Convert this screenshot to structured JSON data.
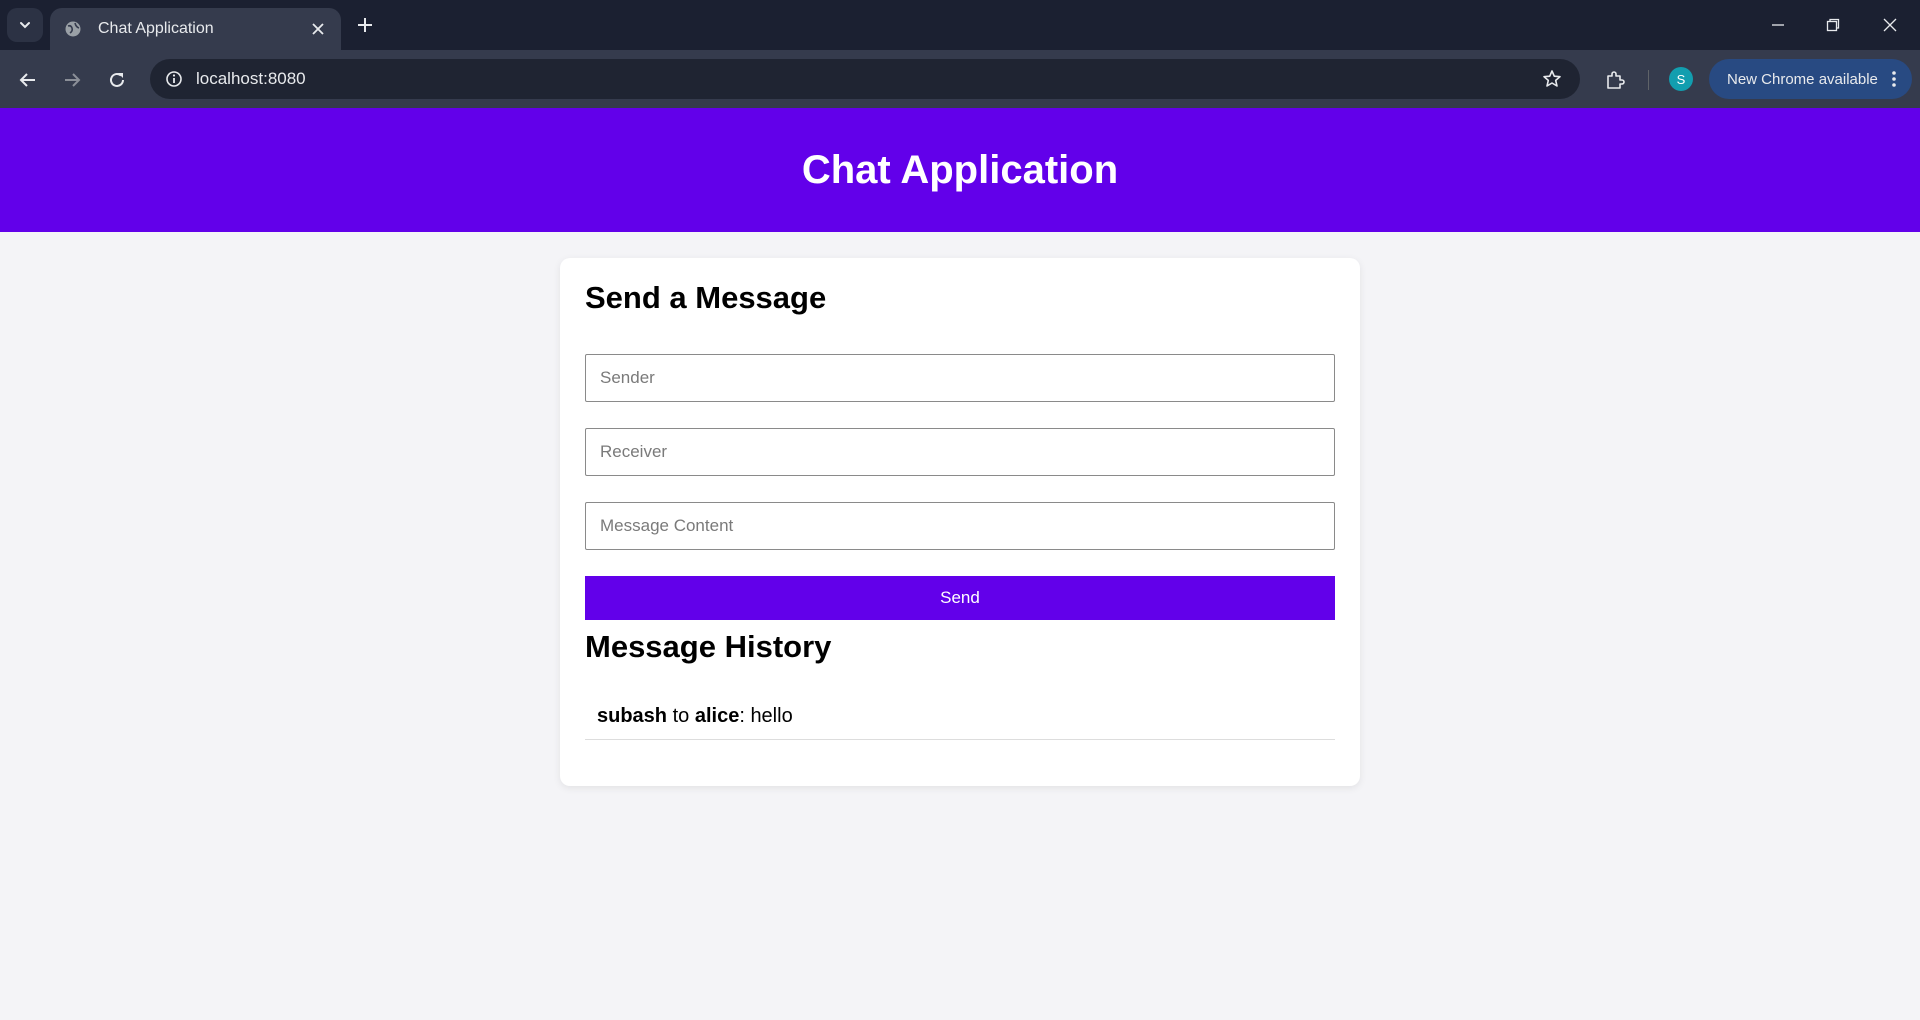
{
  "browser": {
    "tab_title": "Chat Application",
    "url": "localhost:8080",
    "profile_initial": "S",
    "update_label": "New Chrome available"
  },
  "colors": {
    "accent": "#6200ea",
    "page_background": "#f4f4f7",
    "chrome_dark": "#1b2031",
    "chrome_toolbar": "#353b4d",
    "update_pill": "#284a82"
  },
  "header": {
    "title": "Chat Application"
  },
  "send_form": {
    "heading": "Send a Message",
    "sender": {
      "placeholder": "Sender",
      "value": ""
    },
    "receiver": {
      "placeholder": "Receiver",
      "value": ""
    },
    "content": {
      "placeholder": "Message Content",
      "value": ""
    },
    "send_label": "Send"
  },
  "history": {
    "heading": "Message History",
    "connector": " to ",
    "separator": ": ",
    "messages": [
      {
        "sender": "subash",
        "receiver": "alice",
        "content": "hello"
      }
    ]
  }
}
